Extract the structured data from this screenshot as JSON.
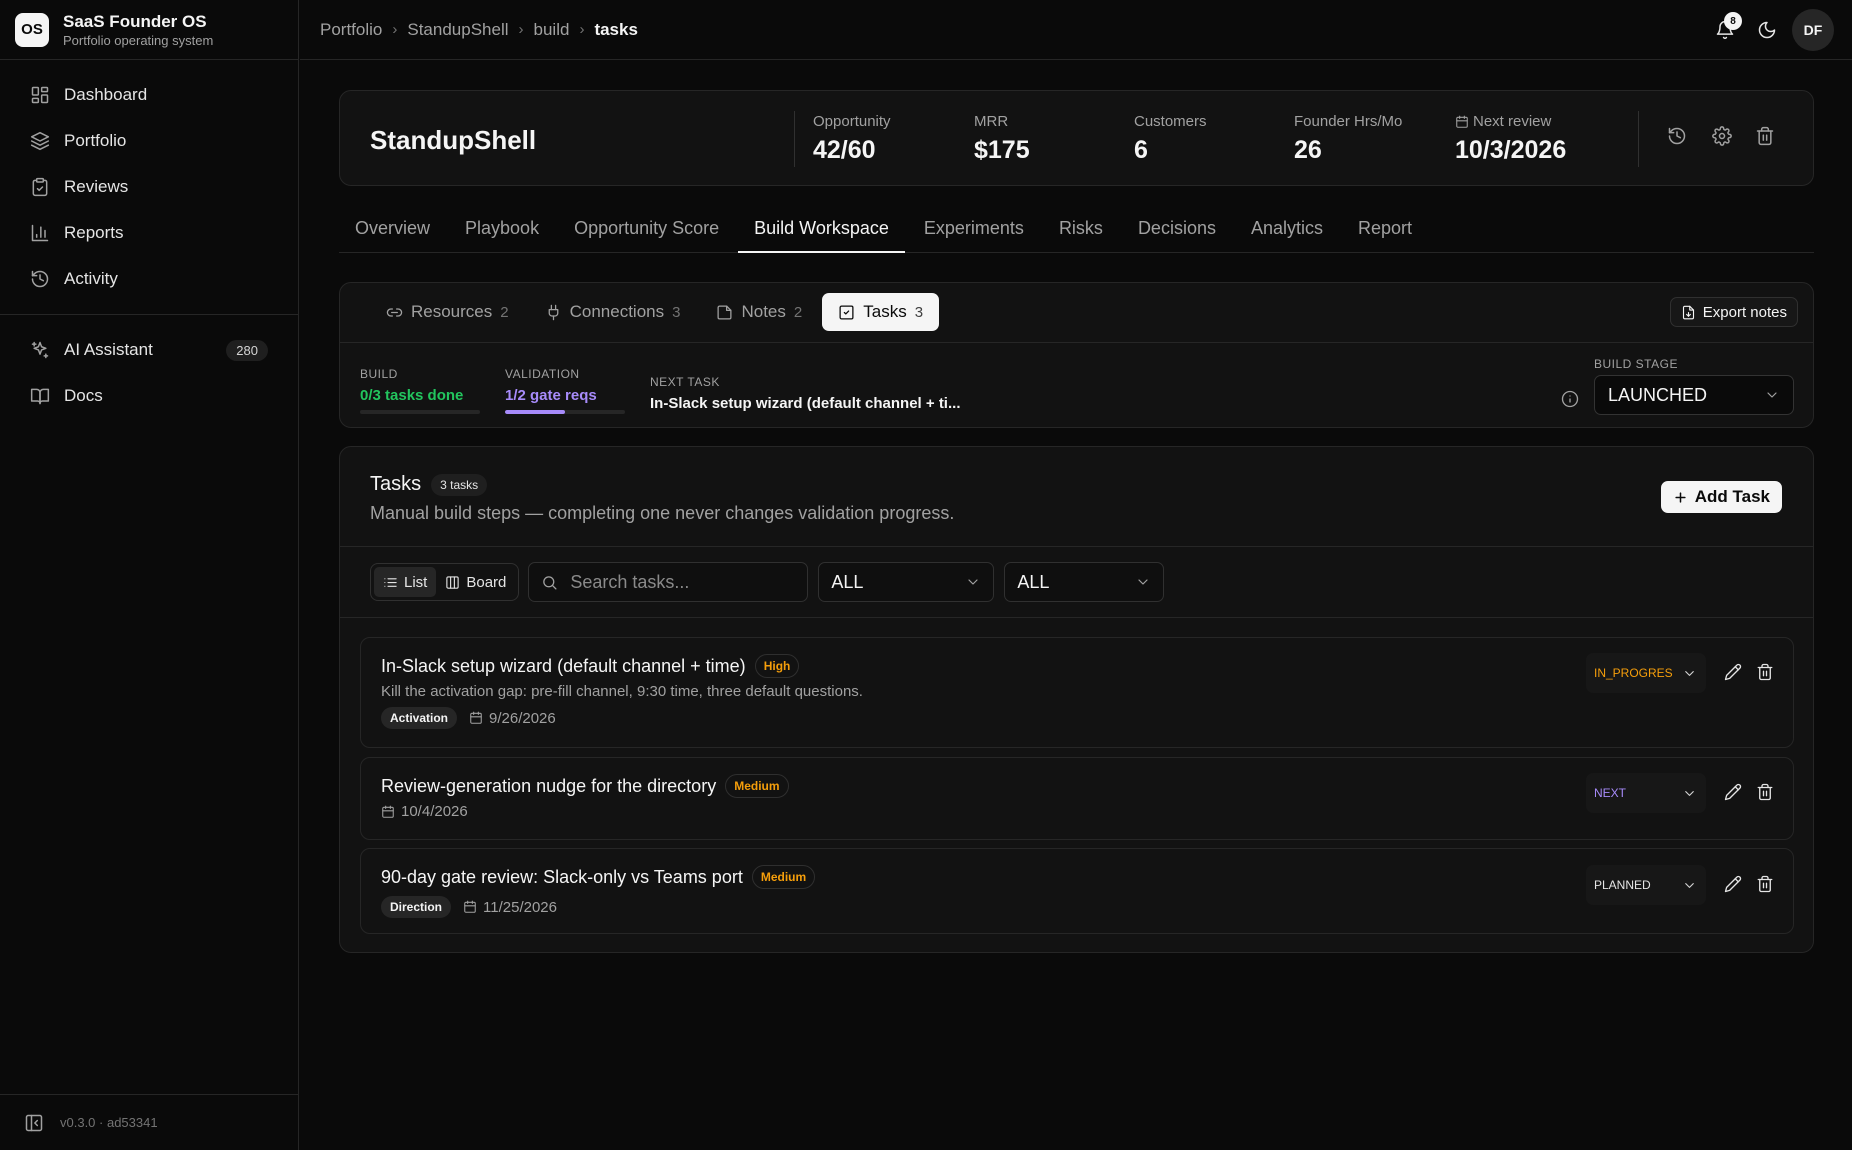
{
  "brand": {
    "logo": "OS",
    "title": "SaaS Founder OS",
    "subtitle": "Portfolio operating system"
  },
  "nav": {
    "items": [
      {
        "label": "Dashboard",
        "icon": "dashboard-icon"
      },
      {
        "label": "Portfolio",
        "icon": "layers-icon"
      },
      {
        "label": "Reviews",
        "icon": "clipboard-check-icon"
      },
      {
        "label": "Reports",
        "icon": "bar-chart-icon"
      },
      {
        "label": "Activity",
        "icon": "history-icon"
      }
    ],
    "secondary": [
      {
        "label": "AI Assistant",
        "icon": "sparkles-icon",
        "badge": "280"
      },
      {
        "label": "Docs",
        "icon": "book-icon"
      }
    ],
    "version": "v0.3.0 · ad53341"
  },
  "breadcrumb": [
    "Portfolio",
    "StandupShell",
    "build",
    "tasks"
  ],
  "topbar": {
    "notifications": "8",
    "avatar": "DF"
  },
  "project": {
    "name": "StandupShell",
    "stats": [
      {
        "label": "Opportunity",
        "value": "42/60"
      },
      {
        "label": "MRR",
        "value": "$175"
      },
      {
        "label": "Customers",
        "value": "6"
      },
      {
        "label": "Founder Hrs/Mo",
        "value": "26"
      },
      {
        "label": "Next review",
        "value": "10/3/2026"
      }
    ]
  },
  "tabs": [
    "Overview",
    "Playbook",
    "Opportunity Score",
    "Build Workspace",
    "Experiments",
    "Risks",
    "Decisions",
    "Analytics",
    "Report"
  ],
  "active_tab": "Build Workspace",
  "workspace": {
    "subtabs": [
      {
        "label": "Resources",
        "count": "2"
      },
      {
        "label": "Connections",
        "count": "3"
      },
      {
        "label": "Notes",
        "count": "2"
      },
      {
        "label": "Tasks",
        "count": "3"
      }
    ],
    "export_label": "Export notes",
    "build": {
      "label": "BUILD",
      "value": "0/3 tasks done",
      "progress": 0,
      "color": "#22c55e"
    },
    "validation": {
      "label": "VALIDATION",
      "value": "1/2 gate reqs",
      "progress": 0.5,
      "color": "#a78bfa"
    },
    "next_task": {
      "label": "NEXT TASK",
      "value": "In-Slack setup wizard (default channel + ti..."
    },
    "build_stage": {
      "label": "BUILD STAGE",
      "value": "LAUNCHED"
    }
  },
  "tasks_panel": {
    "title": "Tasks",
    "count": "3 tasks",
    "subtitle": "Manual build steps — completing one never changes validation progress.",
    "add_label": "Add Task",
    "view_list": "List",
    "view_board": "Board",
    "search_placeholder": "Search tasks...",
    "filter_status": "ALL",
    "filter_priority": "ALL"
  },
  "tasks": [
    {
      "title": "In-Slack setup wizard (default channel + time)",
      "priority": "High",
      "description": "Kill the activation gap: pre-fill channel, 9:30 time, three default questions.",
      "tag": "Activation",
      "date": "9/26/2026",
      "status": "IN_PROGRES",
      "status_color": "#f59e0b"
    },
    {
      "title": "Review-generation nudge for the directory",
      "priority": "Medium",
      "description": "",
      "tag": "",
      "date": "10/4/2026",
      "status": "NEXT",
      "status_color": "#a78bfa"
    },
    {
      "title": "90-day gate review: Slack-only vs Teams port",
      "priority": "Medium",
      "description": "",
      "tag": "Direction",
      "date": "11/25/2026",
      "status": "PLANNED",
      "status_color": "#e5e5e5"
    }
  ]
}
